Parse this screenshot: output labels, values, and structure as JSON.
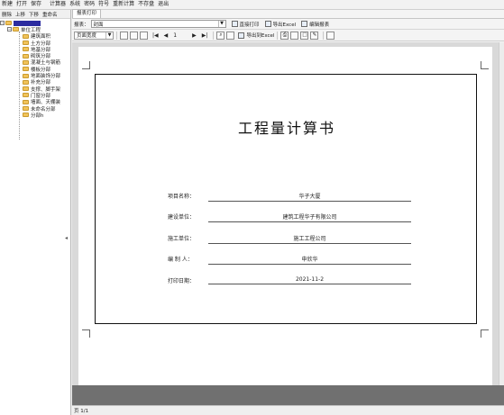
{
  "menu": {
    "items": [
      "新建",
      "打开",
      "保存",
      "计算器",
      "系统",
      "密码",
      "符号",
      "重新计算",
      "不存盘",
      "退出"
    ]
  },
  "tree_toolbar": {
    "items": [
      "删除",
      "上移",
      "下移",
      "重命名"
    ]
  },
  "tree": {
    "root_label": "",
    "project_label": "单位工程",
    "children": [
      "建筑面积",
      "土方分部",
      "地基分部",
      "砌筑分部",
      "混凝土与钢筋",
      "楼板分部",
      "地面装饰分部",
      "补充分部",
      "支撑、脚手架",
      "门窗分部",
      "墙面、天棚装",
      "未命名分部",
      "分部h"
    ]
  },
  "report_tab": {
    "label": "报表打印"
  },
  "report_bar": {
    "report_label": "报表：",
    "report_value": "封面",
    "direct_print": "直接打印",
    "export_excel": "导出Excel",
    "edit_report": "编辑报表"
  },
  "preview_bar": {
    "zoom_value": "页面宽度",
    "page_indicator": "1",
    "export_excel": "导出到Excel"
  },
  "document": {
    "title": "工程量计算书",
    "fields": [
      {
        "label": "项目名称：",
        "value": "华子大厦"
      },
      {
        "label": "建设单位：",
        "value": "建筑工程华子有限公司"
      },
      {
        "label": "施工单位：",
        "value": "施工工程公司"
      },
      {
        "label": "编  制  人：",
        "value": "申欣华"
      },
      {
        "label": "打印日期：",
        "value": "2021-11-2"
      }
    ]
  },
  "status": {
    "page": "页 1/1"
  },
  "colors": {
    "tree_selected": "#2c2ca0",
    "folder": "#f1c35a",
    "canvas_band": "#707070"
  }
}
